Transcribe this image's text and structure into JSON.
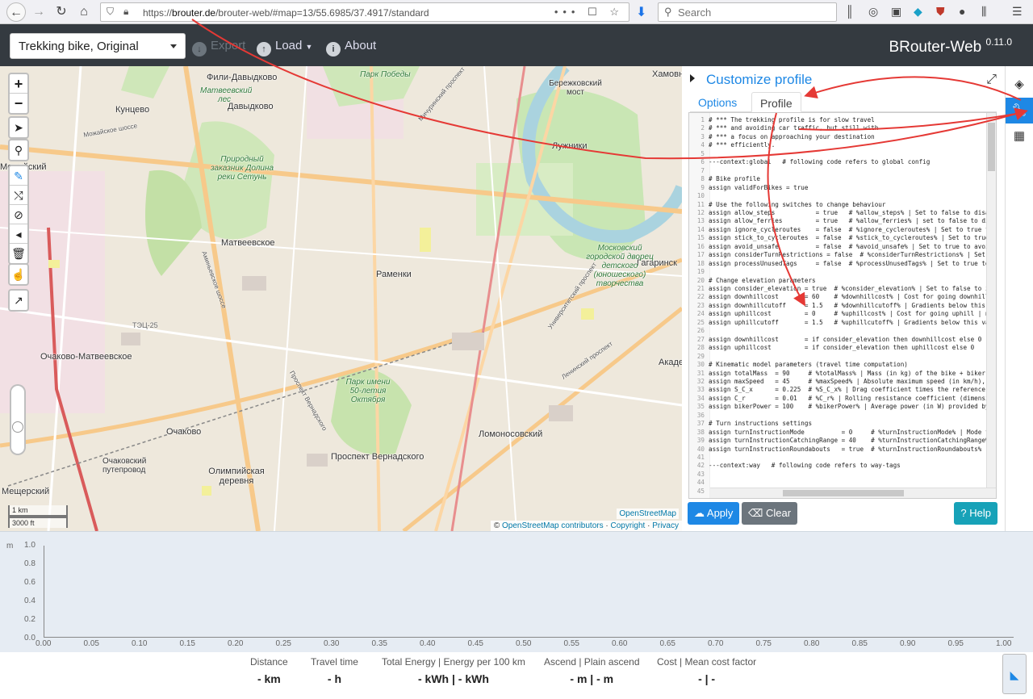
{
  "browser": {
    "url_domain": "brouter.de",
    "url_prefix": "https://",
    "url_path": "/brouter-web/#map=13/55.6985/37.4917/standard",
    "url_right_icons": "••• ☐ ☆",
    "search_placeholder": "Search"
  },
  "header": {
    "profile_selected": "Trekking bike, Original",
    "export_label": "Export",
    "load_label": "Load",
    "about_label": "About",
    "brand": "BRouter-Web",
    "version": "0.11.0"
  },
  "map": {
    "labels": [
      "Фили-Давыдково",
      "Кунцево",
      "Давыдково",
      "Можайский",
      "Матвеевское",
      "Раменки",
      "Очаково-Матвеевское",
      "Очаково",
      "Очаковский путепровод",
      "Олимпийская деревня",
      "Проспект Вернадского",
      "Ломоносовский",
      "Мещерский",
      "Лужники",
      "Бережковский мост",
      "Хамовн",
      "Гагаринск",
      "Акаде",
      "Парк Победы",
      "Природный заказник Долина реки Сетунь",
      "Парк имени 50-летия Октября",
      "Московский городской дворец детского (юношеского) творчества",
      "ТЭЦ-25",
      "Матвеевский лес"
    ],
    "streets": [
      "Можайское шоссе",
      "Мичуринский проспект",
      "Ленинский проспект",
      "Проспект Вернадского",
      "Аминьевское шоссе",
      "Университетский проспект"
    ],
    "scale_km": "1 km",
    "scale_ft": "3000 ft",
    "osm_tag": "OpenStreetMap",
    "attribution_prefix": "© ",
    "attribution_link": "OpenStreetMap contributors",
    "attribution_sep1": " · ",
    "attribution_copyright": "Copyright",
    "attribution_sep2": " · ",
    "attribution_privacy": "Privacy"
  },
  "sidebar": {
    "title": "Customize profile",
    "tabs": [
      "Options",
      "Profile"
    ],
    "apply_label": "Apply",
    "clear_label": "Clear",
    "help_label": "Help",
    "code_lines": [
      {
        "n": "1",
        "t": "# *** The trekking profile is for slow travel"
      },
      {
        "n": "2",
        "t": "# *** and avoiding car traffic, but still with"
      },
      {
        "n": "3",
        "t": "# *** a focus on approaching your destination"
      },
      {
        "n": "4",
        "t": "# *** efficiently."
      },
      {
        "n": "5",
        "t": ""
      },
      {
        "n": "6",
        "t": "---context:global   # following code refers to global config"
      },
      {
        "n": "7",
        "t": ""
      },
      {
        "n": "8",
        "t": "# Bike profile"
      },
      {
        "n": "9",
        "t": "assign validForBikes = true"
      },
      {
        "n": "10",
        "t": ""
      },
      {
        "n": "11",
        "t": "# Use the following switches to change behaviour"
      },
      {
        "n": "12",
        "t": "assign allow_steps           = true   # %allow_steps% | Set to false to disallow"
      },
      {
        "n": "13",
        "t": "assign allow_ferries         = true   # %allow_ferries% | set to false to disallow"
      },
      {
        "n": "14",
        "t": "assign ignore_cycleroutes    = false  # %ignore_cycleroutes% | Set to true for better"
      },
      {
        "n": "15",
        "t": "assign stick_to_cycleroutes  = false  # %stick_to_cycleroutes% | Set to true to just"
      },
      {
        "n": "16",
        "t": "assign avoid_unsafe          = false  # %avoid_unsafe% | Set to true to avoid"
      },
      {
        "n": "17",
        "t": "assign considerTurnRestrictions = false  # %considerTurnRestrictions% | Set to true"
      },
      {
        "n": "18",
        "t": "assign processUnusedTags     = false  # %processUnusedTags% | Set to true to"
      },
      {
        "n": "19",
        "t": ""
      },
      {
        "n": "20",
        "t": "# Change elevation parameters"
      },
      {
        "n": "21",
        "t": "assign consider_elevation = true  # %consider_elevation% | Set to false to ignore"
      },
      {
        "n": "22",
        "t": "assign downhillcost       = 60    # %downhillcost% | Cost for going downhill"
      },
      {
        "n": "23",
        "t": "assign downhillcutoff     = 1.5   # %downhillcutoff% | Gradients below this value"
      },
      {
        "n": "24",
        "t": "assign uphillcost         = 0     # %uphillcost% | Cost for going uphill | num"
      },
      {
        "n": "25",
        "t": "assign uphillcutoff       = 1.5   # %uphillcutoff% | Gradients below this value"
      },
      {
        "n": "26",
        "t": ""
      },
      {
        "n": "27",
        "t": "assign downhillcost       = if consider_elevation then downhillcost else 0"
      },
      {
        "n": "28",
        "t": "assign uphillcost         = if consider_elevation then uphillcost else 0"
      },
      {
        "n": "29",
        "t": ""
      },
      {
        "n": "30",
        "t": "# Kinematic model parameters (travel time computation)"
      },
      {
        "n": "31",
        "t": "assign totalMass  = 90     # %totalMass% | Mass (in kg) of the bike + biker,"
      },
      {
        "n": "32",
        "t": "assign maxSpeed   = 45     # %maxSpeed% | Absolute maximum speed (in km/h),"
      },
      {
        "n": "33",
        "t": "assign S_C_x      = 0.225  # %S_C_x% | Drag coefficient times the reference area"
      },
      {
        "n": "34",
        "t": "assign C_r        = 0.01   # %C_r% | Rolling resistance coefficient (dimensionless)"
      },
      {
        "n": "35",
        "t": "assign bikerPower = 100    # %bikerPower% | Average power (in W) provided by"
      },
      {
        "n": "36",
        "t": ""
      },
      {
        "n": "37",
        "t": "# Turn instructions settings"
      },
      {
        "n": "38",
        "t": "assign turnInstructionMode          = 0     # %turnInstructionMode% | Mode for"
      },
      {
        "n": "39",
        "t": "assign turnInstructionCatchingRange = 40    # %turnInstructionCatchingRange% |"
      },
      {
        "n": "40",
        "t": "assign turnInstructionRoundabouts   = true  # %turnInstructionRoundabouts% |"
      },
      {
        "n": "41",
        "t": ""
      },
      {
        "n": "42",
        "t": "---context:way   # following code refers to way-tags"
      },
      {
        "n": "43",
        "t": ""
      },
      {
        "n": "44",
        "t": ""
      },
      {
        "n": "45",
        "t": ""
      }
    ]
  },
  "elevation": {
    "y_unit": "m",
    "y_ticks": [
      "1.0",
      "0.8",
      "0.6",
      "0.4",
      "0.2",
      "0.0"
    ],
    "x_ticks": [
      "0.00",
      "0.05",
      "0.10",
      "0.15",
      "0.20",
      "0.25",
      "0.30",
      "0.35",
      "0.40",
      "0.45",
      "0.50",
      "0.55",
      "0.60",
      "0.65",
      "0.70",
      "0.75",
      "0.80",
      "0.85",
      "0.90",
      "0.95",
      "1.00"
    ]
  },
  "summary": [
    {
      "label": "Distance",
      "value": "- km"
    },
    {
      "label": "Travel time",
      "value": "- h"
    },
    {
      "label": "Total Energy | Energy per 100 km",
      "value": "- kWh | - kWh"
    },
    {
      "label": "Ascend | Plain ascend",
      "value": "- m | - m"
    },
    {
      "label": "Cost | Mean cost factor",
      "value": "- | -"
    }
  ],
  "colors": {
    "accent": "#1e88e5",
    "header_bg": "#343a40",
    "annotation": "#e53935"
  }
}
